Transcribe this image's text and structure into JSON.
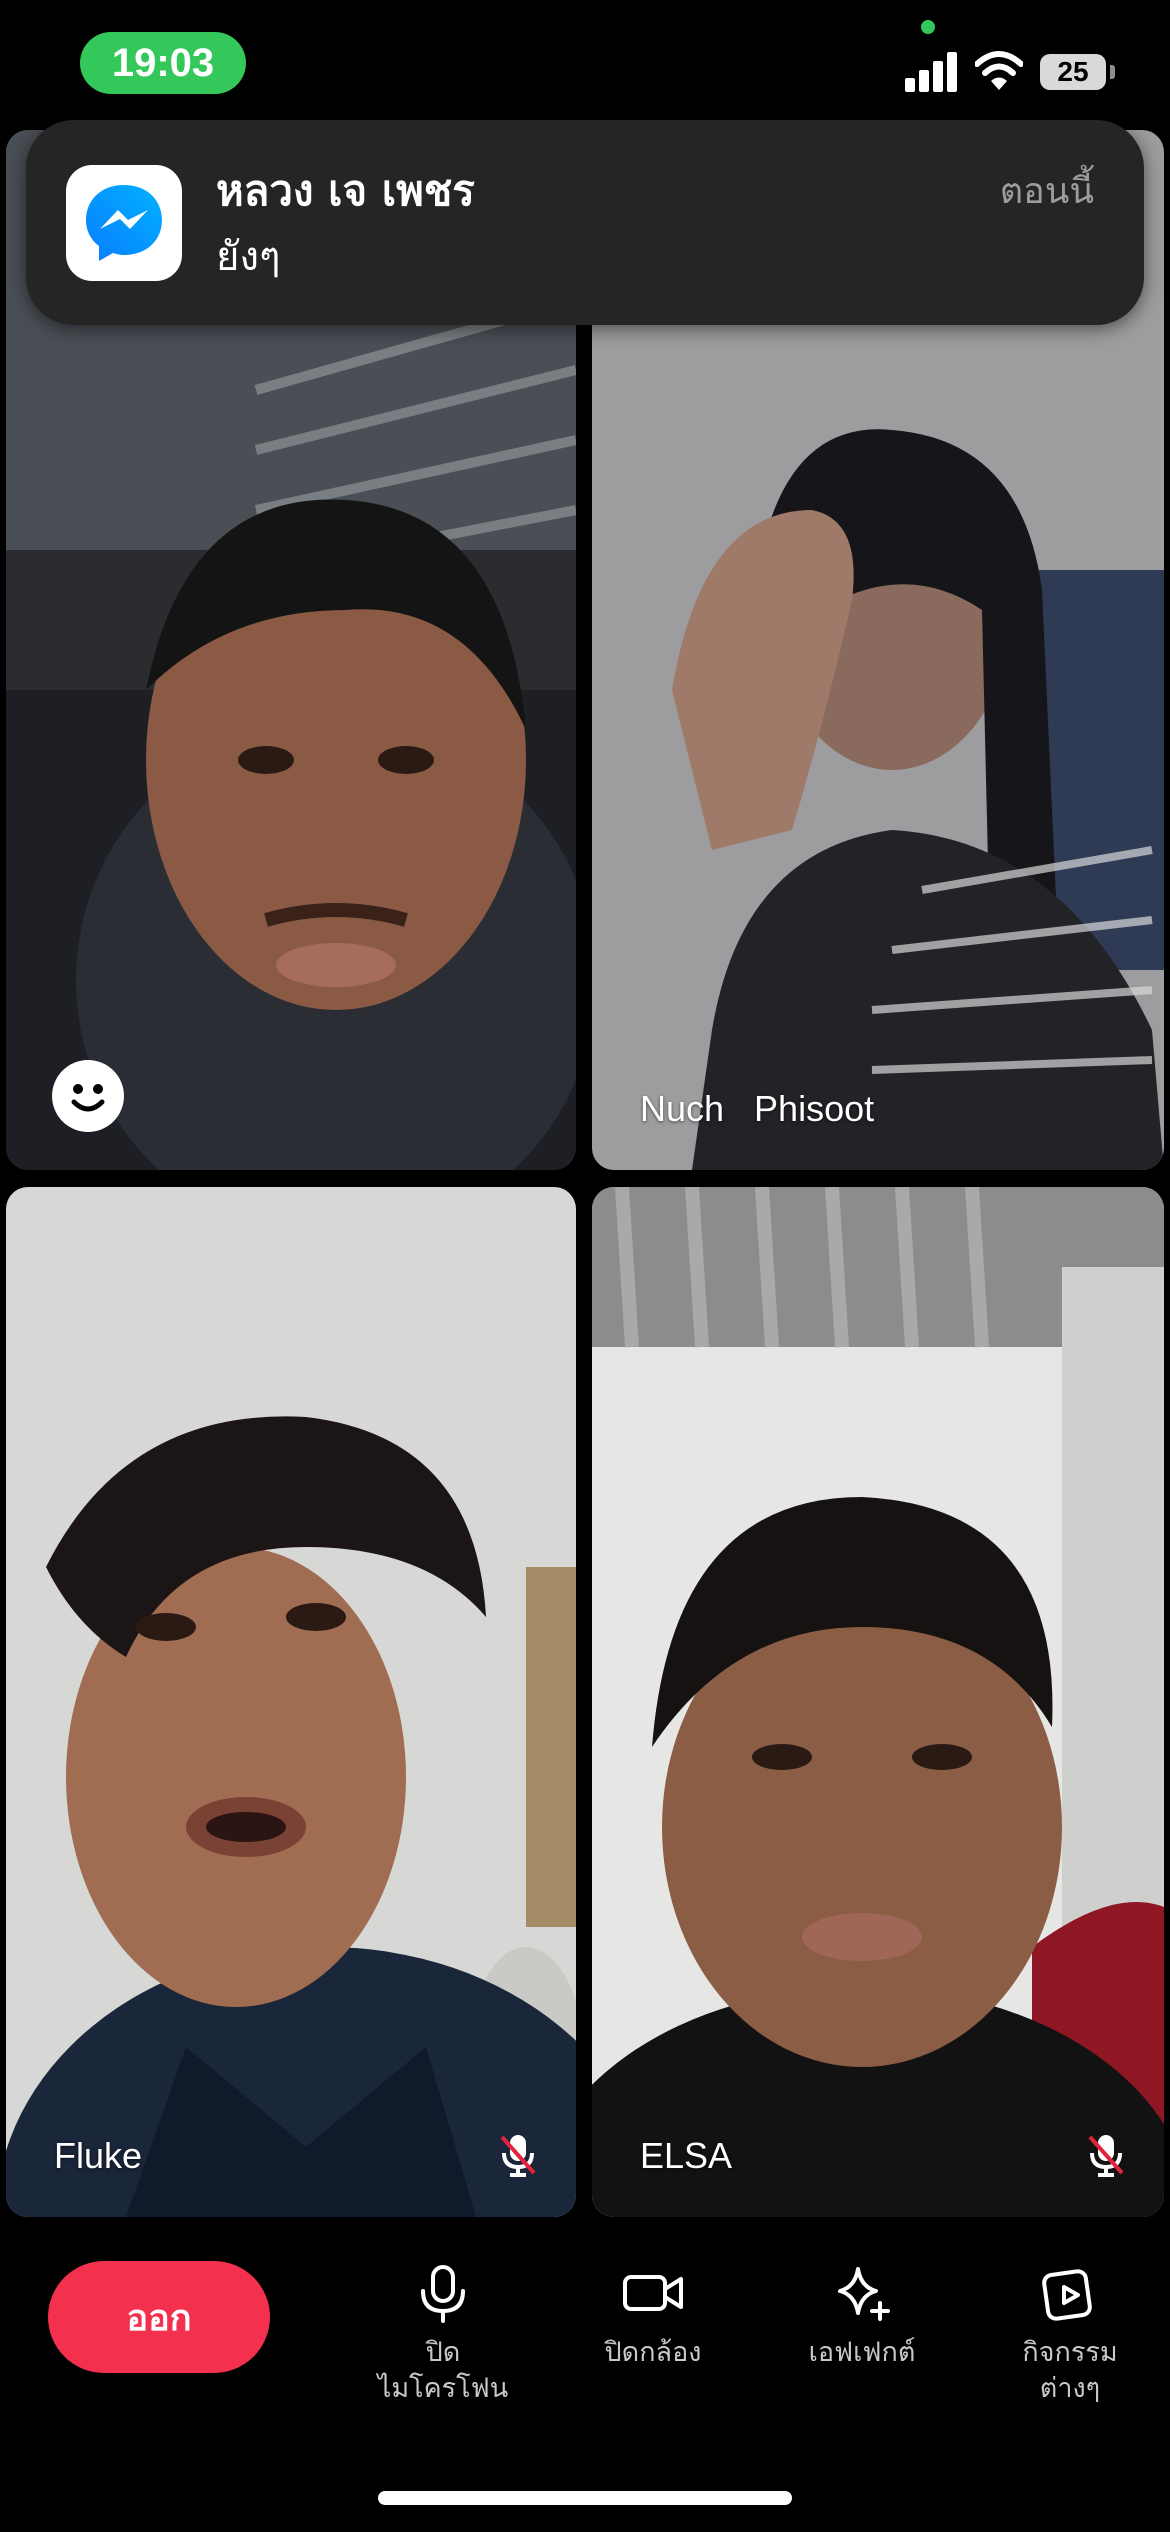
{
  "status_bar": {
    "time": "19:03",
    "battery": "25",
    "colors": {
      "time_pill": "#34c759",
      "privacy_dot": "#34c759"
    }
  },
  "notification": {
    "app_icon": "messenger-icon",
    "title": "หลวง เจ เพชร",
    "message": "ยังๆ",
    "time": "ตอนนี้"
  },
  "participants": [
    {
      "name": "",
      "muted": false,
      "reaction_button": "smiley-icon"
    },
    {
      "name": "Nuch   Phisoot",
      "muted": false
    },
    {
      "name": "Fluke",
      "muted": true
    },
    {
      "name": "ELSA",
      "muted": true
    }
  ],
  "controls": {
    "leave": "ออก",
    "mic": "ปิด\nไมโครโฟน",
    "camera": "ปิดกล้อง",
    "effects": "เอฟเฟกต์",
    "activities": "กิจกรรม\nต่างๆ",
    "colors": {
      "leave": "#f4304f"
    }
  }
}
